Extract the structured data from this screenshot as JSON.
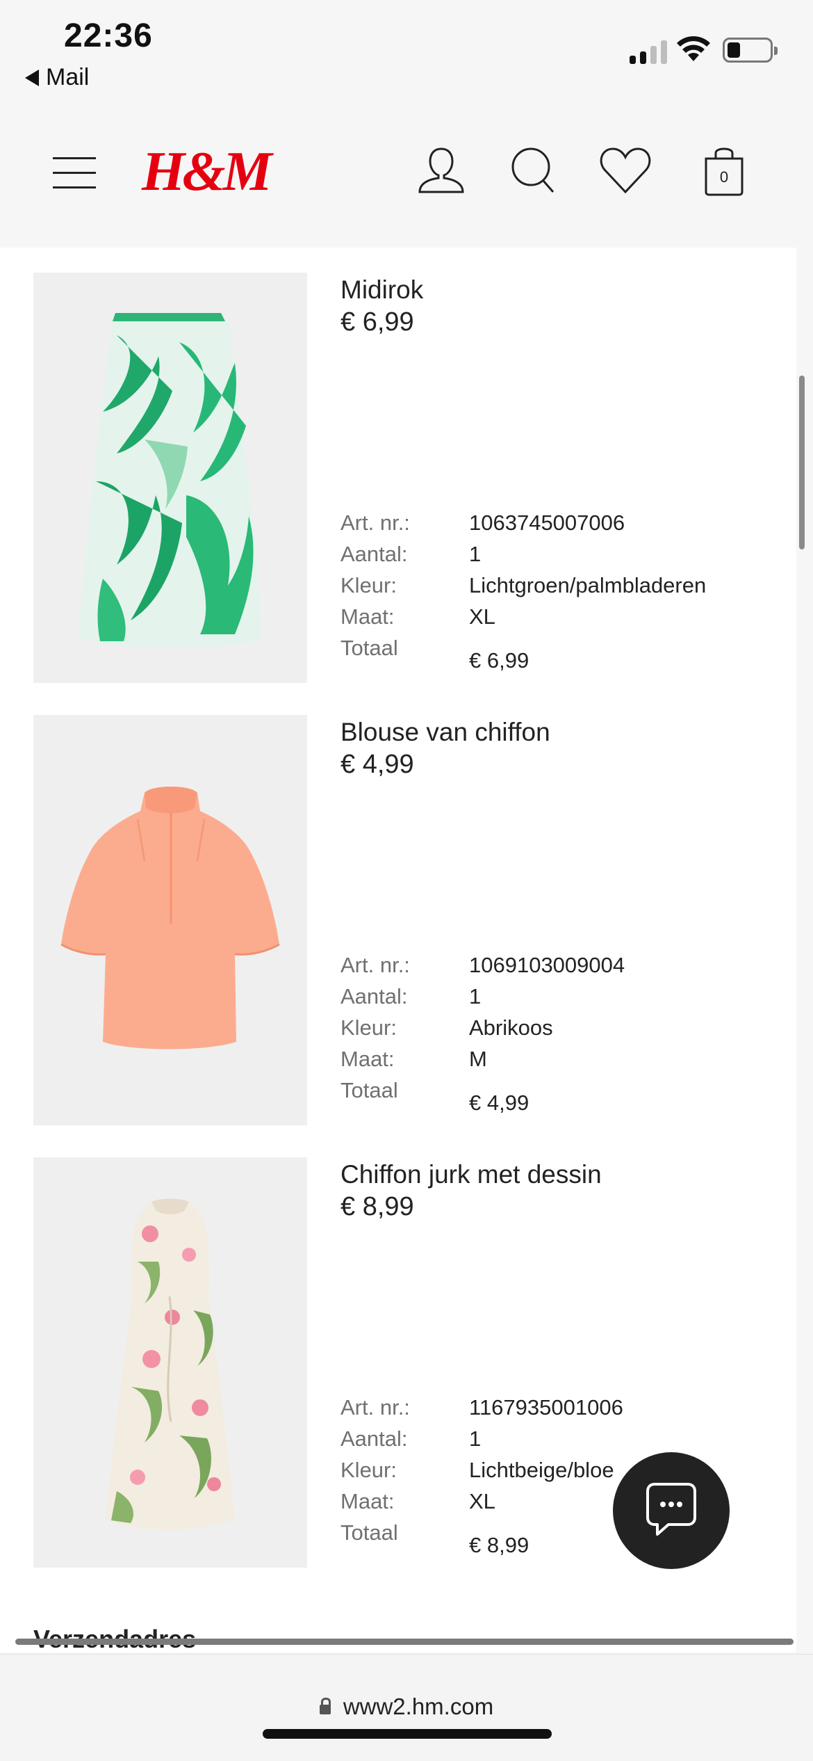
{
  "status_bar": {
    "time": "22:36",
    "back_label": "Mail"
  },
  "header": {
    "logo": "H&M",
    "cart_count": "0",
    "icons": [
      "menu-icon",
      "account-icon",
      "search-icon",
      "heart-icon",
      "bag-icon"
    ]
  },
  "labels": {
    "art_nr": "Art. nr.:",
    "aantal": "Aantal:",
    "kleur": "Kleur:",
    "maat": "Maat:",
    "totaal": "Totaal"
  },
  "items": [
    {
      "name": "Midirok",
      "price": "€ 6,99",
      "art_nr": "1063745007006",
      "aantal": "1",
      "kleur": "Lichtgroen/palmbladeren",
      "maat": "XL",
      "totaal": "€ 6,99"
    },
    {
      "name": "Blouse van chiffon",
      "price": "€ 4,99",
      "art_nr": "1069103009004",
      "aantal": "1",
      "kleur": "Abrikoos",
      "maat": "M",
      "totaal": "€ 4,99"
    },
    {
      "name": "Chiffon jurk met dessin",
      "price": "€ 8,99",
      "art_nr": "1167935001006",
      "aantal": "1",
      "kleur": "Lichtbeige/bloe",
      "maat": "XL",
      "totaal": "€ 8,99"
    }
  ],
  "section_title": "Verzendadres",
  "url": "www2.hm.com",
  "colors": {
    "brand": "#e50010",
    "chat_bg": "#222222"
  }
}
